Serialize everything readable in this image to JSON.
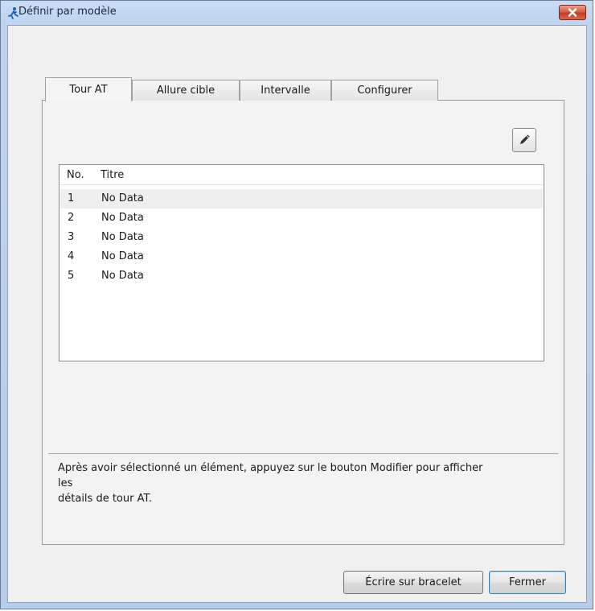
{
  "window": {
    "title": "Définir par modèle"
  },
  "tabs": [
    {
      "label": "Tour AT",
      "active": true
    },
    {
      "label": "Allure cible",
      "active": false
    },
    {
      "label": "Intervalle",
      "active": false
    },
    {
      "label": "Configurer",
      "active": false
    }
  ],
  "toolbar": {
    "edit_icon": "pencil-icon"
  },
  "list": {
    "columns": [
      "No.",
      "Titre"
    ],
    "rows": [
      {
        "no": "1",
        "title": "No Data"
      },
      {
        "no": "2",
        "title": "No Data"
      },
      {
        "no": "3",
        "title": "No Data"
      },
      {
        "no": "4",
        "title": "No Data"
      },
      {
        "no": "5",
        "title": "No Data"
      }
    ]
  },
  "help_text": "Après avoir sélectionné un élément, appuyez sur le bouton Modifier pour afficher\nles\ndétails de tour AT.",
  "buttons": {
    "write": "Écrire sur bracelet",
    "close": "Fermer"
  },
  "colors": {
    "title_bar": "#c2d6f0",
    "close_button": "#c94a32",
    "default_button_border": "#3c7fb1"
  }
}
